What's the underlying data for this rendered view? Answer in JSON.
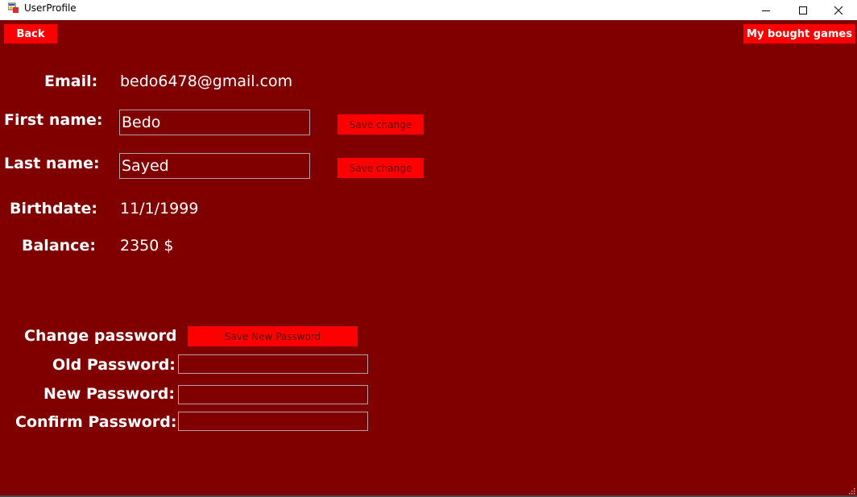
{
  "window": {
    "title": "UserProfile"
  },
  "toolbar": {
    "back_label": "Back",
    "bought_games_label": "My bought games"
  },
  "profile": {
    "email_label": "Email:",
    "email_value": "bedo6478@gmail.com",
    "first_name_label": "First name:",
    "first_name_value": "Bedo",
    "last_name_label": "Last name:",
    "last_name_value": "Sayed",
    "birthdate_label": "Birthdate:",
    "birthdate_value": "11/1/1999",
    "balance_label": "Balance:",
    "balance_value": "2350 $",
    "save_change_label": "Save change"
  },
  "password": {
    "heading": "Change password",
    "save_label": "Save New Password",
    "old_label": "Old Password:",
    "new_label": "New Password:",
    "confirm_label": "Confirm Password:",
    "old_value": "",
    "new_value": "",
    "confirm_value": ""
  },
  "colors": {
    "background": "#800000",
    "button": "#ff0000",
    "text": "#ffffff"
  }
}
